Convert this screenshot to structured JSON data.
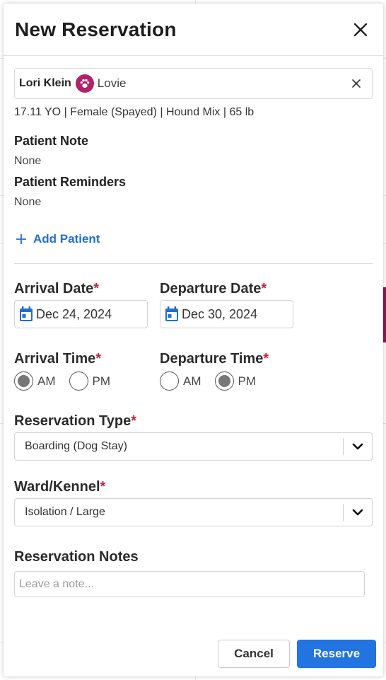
{
  "modal": {
    "title": "New Reservation",
    "close_icon": "close-icon"
  },
  "patient": {
    "owner_name": "Lori Klein",
    "pet_name": "Lovie",
    "paw_icon": "paw-icon",
    "badge_color": "#b0236b",
    "details": "17.11 YO | Female (Spayed) | Hound Mix | 65 lb",
    "note_label": "Patient Note",
    "note_value": "None",
    "reminders_label": "Patient Reminders",
    "reminders_value": "None",
    "add_patient_label": "Add Patient"
  },
  "form": {
    "arrival_date_label": "Arrival Date",
    "arrival_date_value": "Dec 24, 2024",
    "departure_date_label": "Departure Date",
    "departure_date_value": "Dec 30, 2024",
    "arrival_time_label": "Arrival Time",
    "departure_time_label": "Departure Time",
    "am_label": "AM",
    "pm_label": "PM",
    "arrival_time_selected": "AM",
    "departure_time_selected": "PM",
    "required_mark": "*",
    "reservation_type_label": "Reservation Type",
    "reservation_type_value": "Boarding (Dog Stay)",
    "ward_label": "Ward/Kennel",
    "ward_value": "Isolation / Large",
    "notes_label": "Reservation Notes",
    "notes_placeholder": "Leave a note..."
  },
  "footer": {
    "cancel_label": "Cancel",
    "reserve_label": "Reserve",
    "primary_color": "#2274e0"
  }
}
